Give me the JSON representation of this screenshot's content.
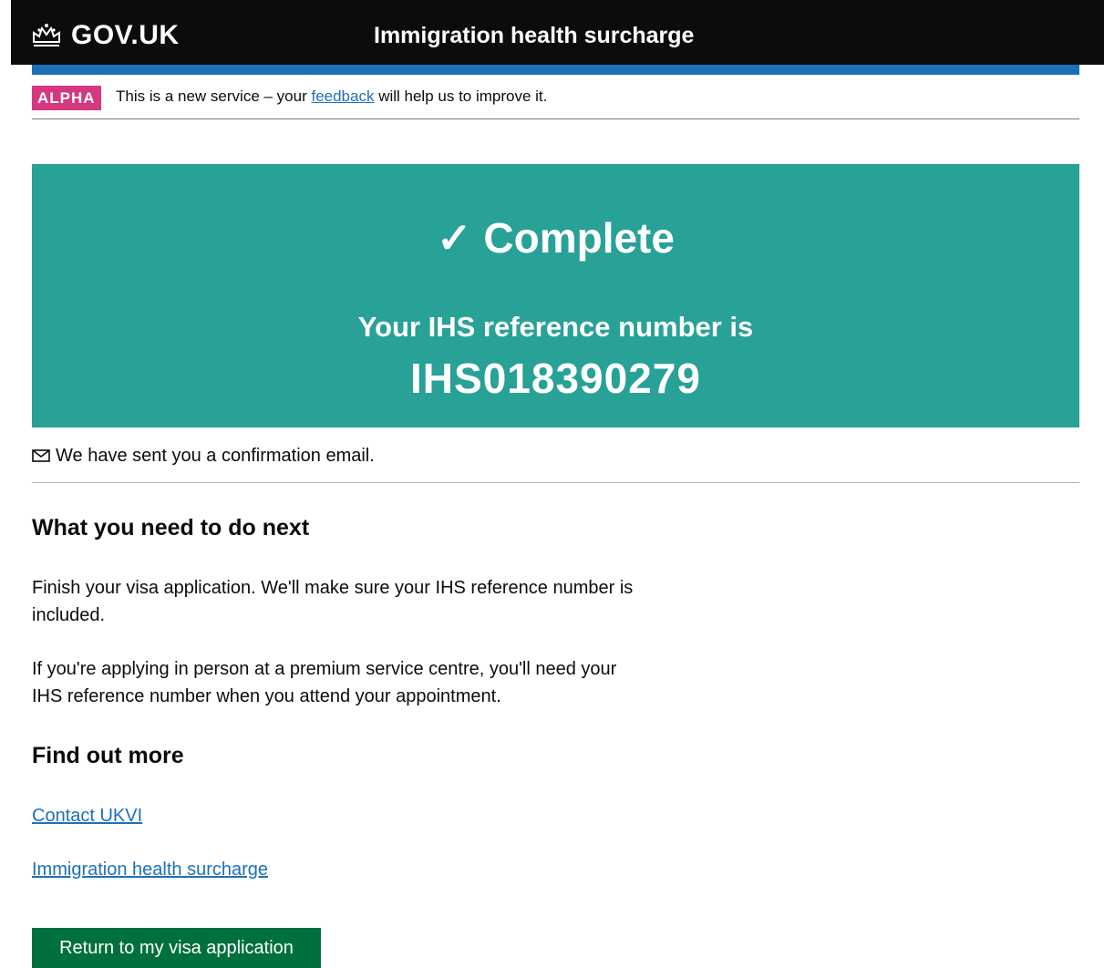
{
  "header": {
    "logo_text": "GOV.UK",
    "service_name": "Immigration health surcharge"
  },
  "phase_banner": {
    "tag": "ALPHA",
    "text_before": "This is a new service – your ",
    "link_text": "feedback",
    "text_after": " will help us to improve it."
  },
  "confirmation": {
    "title": "✓ Complete",
    "reference_label": "Your IHS reference number is",
    "reference_number": "IHS018390279"
  },
  "email_note": "We have sent you a confirmation email.",
  "next_steps": {
    "heading": "What you need to do next",
    "para1": "Finish your visa application. We'll make sure your IHS reference number is included.",
    "para2": "If you're applying in person at a premium service centre, you'll need your IHS reference number when you attend your appointment."
  },
  "find_out_more": {
    "heading": "Find out more",
    "links": [
      "Contact UKVI",
      "Immigration health surcharge"
    ]
  },
  "actions": {
    "return_button": "Return to my visa application"
  },
  "colors": {
    "header_bg": "#0b0c0c",
    "blue_bar": "#1d70b8",
    "alpha_tag": "#d53880",
    "panel_bg": "#28a197",
    "link": "#1d70b8",
    "button_bg": "#00703c"
  },
  "icons": {
    "logo": "crown-icon",
    "email": "mail-icon"
  }
}
